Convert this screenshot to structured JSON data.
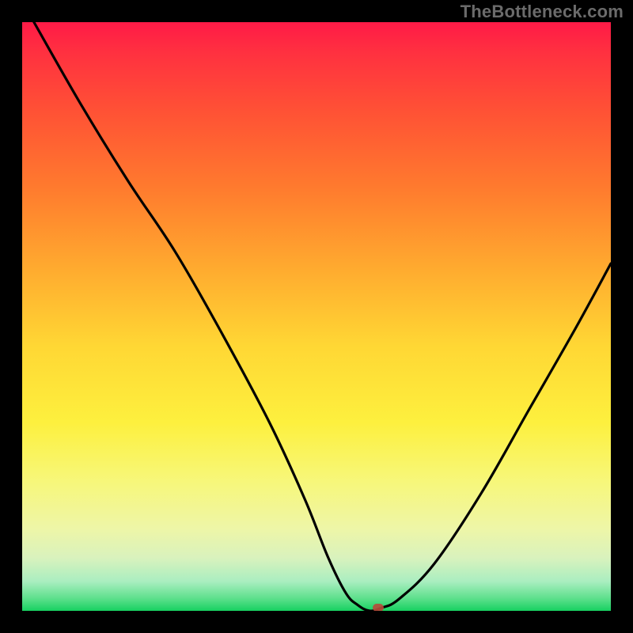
{
  "watermark": "TheBottleneck.com",
  "chart_data": {
    "type": "line",
    "title": "",
    "xlabel": "",
    "ylabel": "",
    "xlim": [
      0,
      100
    ],
    "ylim": [
      0,
      100
    ],
    "grid": false,
    "legend": false,
    "series": [
      {
        "name": "curve",
        "x": [
          2,
          10,
          18,
          26,
          34,
          42,
          48,
          52,
          55,
          57,
          59,
          61,
          64,
          70,
          78,
          86,
          94,
          100
        ],
        "y": [
          100,
          86,
          73,
          61,
          47,
          32,
          19,
          9,
          3,
          1,
          0,
          0.5,
          2,
          8,
          20,
          34,
          48,
          59
        ]
      }
    ],
    "marker": {
      "x": 60.5,
      "y": 0.6,
      "color": "#b84a3a"
    },
    "background_gradient": {
      "orientation": "vertical",
      "stops": [
        {
          "pos": 0.0,
          "color": "#ff1a47"
        },
        {
          "pos": 0.28,
          "color": "#ff7a2e"
        },
        {
          "pos": 0.55,
          "color": "#ffd734"
        },
        {
          "pos": 0.78,
          "color": "#f7f77a"
        },
        {
          "pos": 0.95,
          "color": "#aaeec0"
        },
        {
          "pos": 1.0,
          "color": "#17d161"
        }
      ]
    }
  },
  "colors": {
    "frame": "#000000",
    "curve": "#000000",
    "watermark": "#6b6b6b"
  }
}
